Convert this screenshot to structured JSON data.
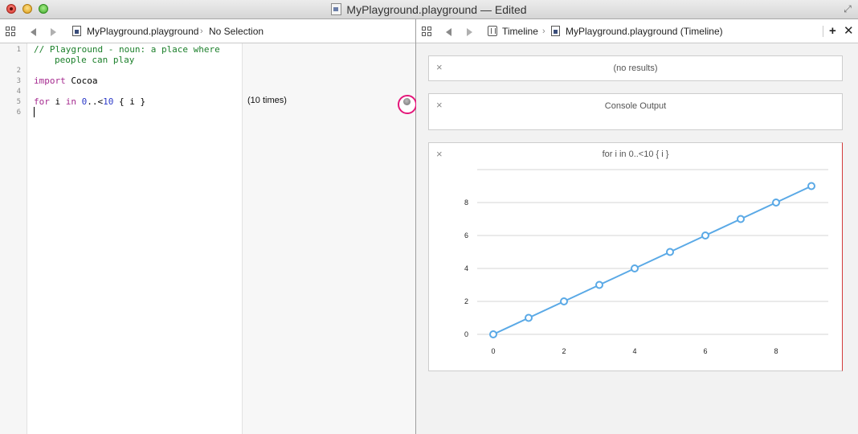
{
  "window": {
    "title": "MyPlayground.playground — Edited"
  },
  "left_jumpbar": {
    "file": "MyPlayground.playground",
    "selection": "No Selection"
  },
  "right_jumpbar": {
    "section": "Timeline",
    "file": "MyPlayground.playground (Timeline)"
  },
  "editor": {
    "line_numbers": [
      "1",
      "2",
      "3",
      "4",
      "5",
      "6"
    ],
    "comment_line1": "// Playground - noun: a place where",
    "comment_line2": "people can play",
    "import_kw": "import",
    "import_mod": "Cocoa",
    "for_kw": "for",
    "for_var": "i",
    "in_kw": "in",
    "range_start": "0",
    "range_op": "..<",
    "range_end": "10",
    "for_body": "{ i }"
  },
  "results": {
    "line5": "(10 times)"
  },
  "timeline": {
    "no_results": "(no results)",
    "console_output": "Console Output",
    "graph_title": "for i in 0..<10 { i }"
  },
  "chart_data": {
    "type": "line",
    "title": "for i in 0..<10 { i }",
    "x": [
      0,
      1,
      2,
      3,
      4,
      5,
      6,
      7,
      8,
      9
    ],
    "y": [
      0,
      1,
      2,
      3,
      4,
      5,
      6,
      7,
      8,
      9
    ],
    "xticks": [
      0,
      2,
      4,
      6,
      8
    ],
    "yticks": [
      0,
      2,
      4,
      6,
      8
    ],
    "xlim": [
      0,
      9
    ],
    "ylim": [
      0,
      9
    ],
    "grid": true,
    "color": "#5aa9e6"
  }
}
